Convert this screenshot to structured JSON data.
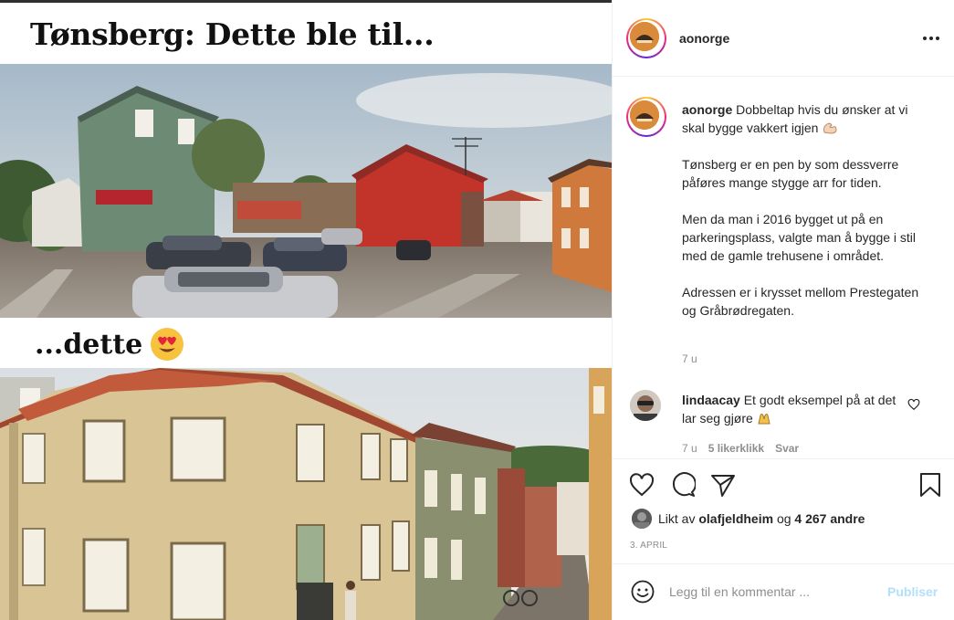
{
  "post_media": {
    "caption_top": "Tønsberg: Dette ble til...",
    "caption_mid": "...dette",
    "emoji_icon": "heart-eyes-emoji"
  },
  "header": {
    "username": "aonorge",
    "more_icon": "more-options-icon"
  },
  "caption": {
    "username": "aonorge",
    "text_first": "Dobbeltap hvis du ønsker at vi skal bygge vakkert igjen",
    "paragraph_2": "Tønsberg er en pen by som dessverre påføres mange stygge arr for tiden.",
    "paragraph_3": "Men da man i 2016 bygget ut på en parkeringsplass, valgte man å bygge i stil med de gamle trehusene i området.",
    "paragraph_4": "Adressen er i krysset mellom Prestegaten og Gråbrødregaten.",
    "time": "7 u"
  },
  "comment": {
    "username": "lindaacay",
    "text": "Et godt eksempel på at det lar seg gjøre",
    "time": "7 u",
    "likes": "5 likerklikk",
    "reply": "Svar"
  },
  "likes": {
    "prefix": "Likt av",
    "user": "olafjeldheim",
    "conj": "og",
    "others": "4 267 andre"
  },
  "date": "3. APRIL",
  "add_comment": {
    "placeholder": "Legg til en kommentar ...",
    "post_label": "Publiser"
  },
  "colors": {
    "post_button_disabled": "#b2dffc",
    "muted_text": "#8e8e8e",
    "text": "#262626"
  }
}
